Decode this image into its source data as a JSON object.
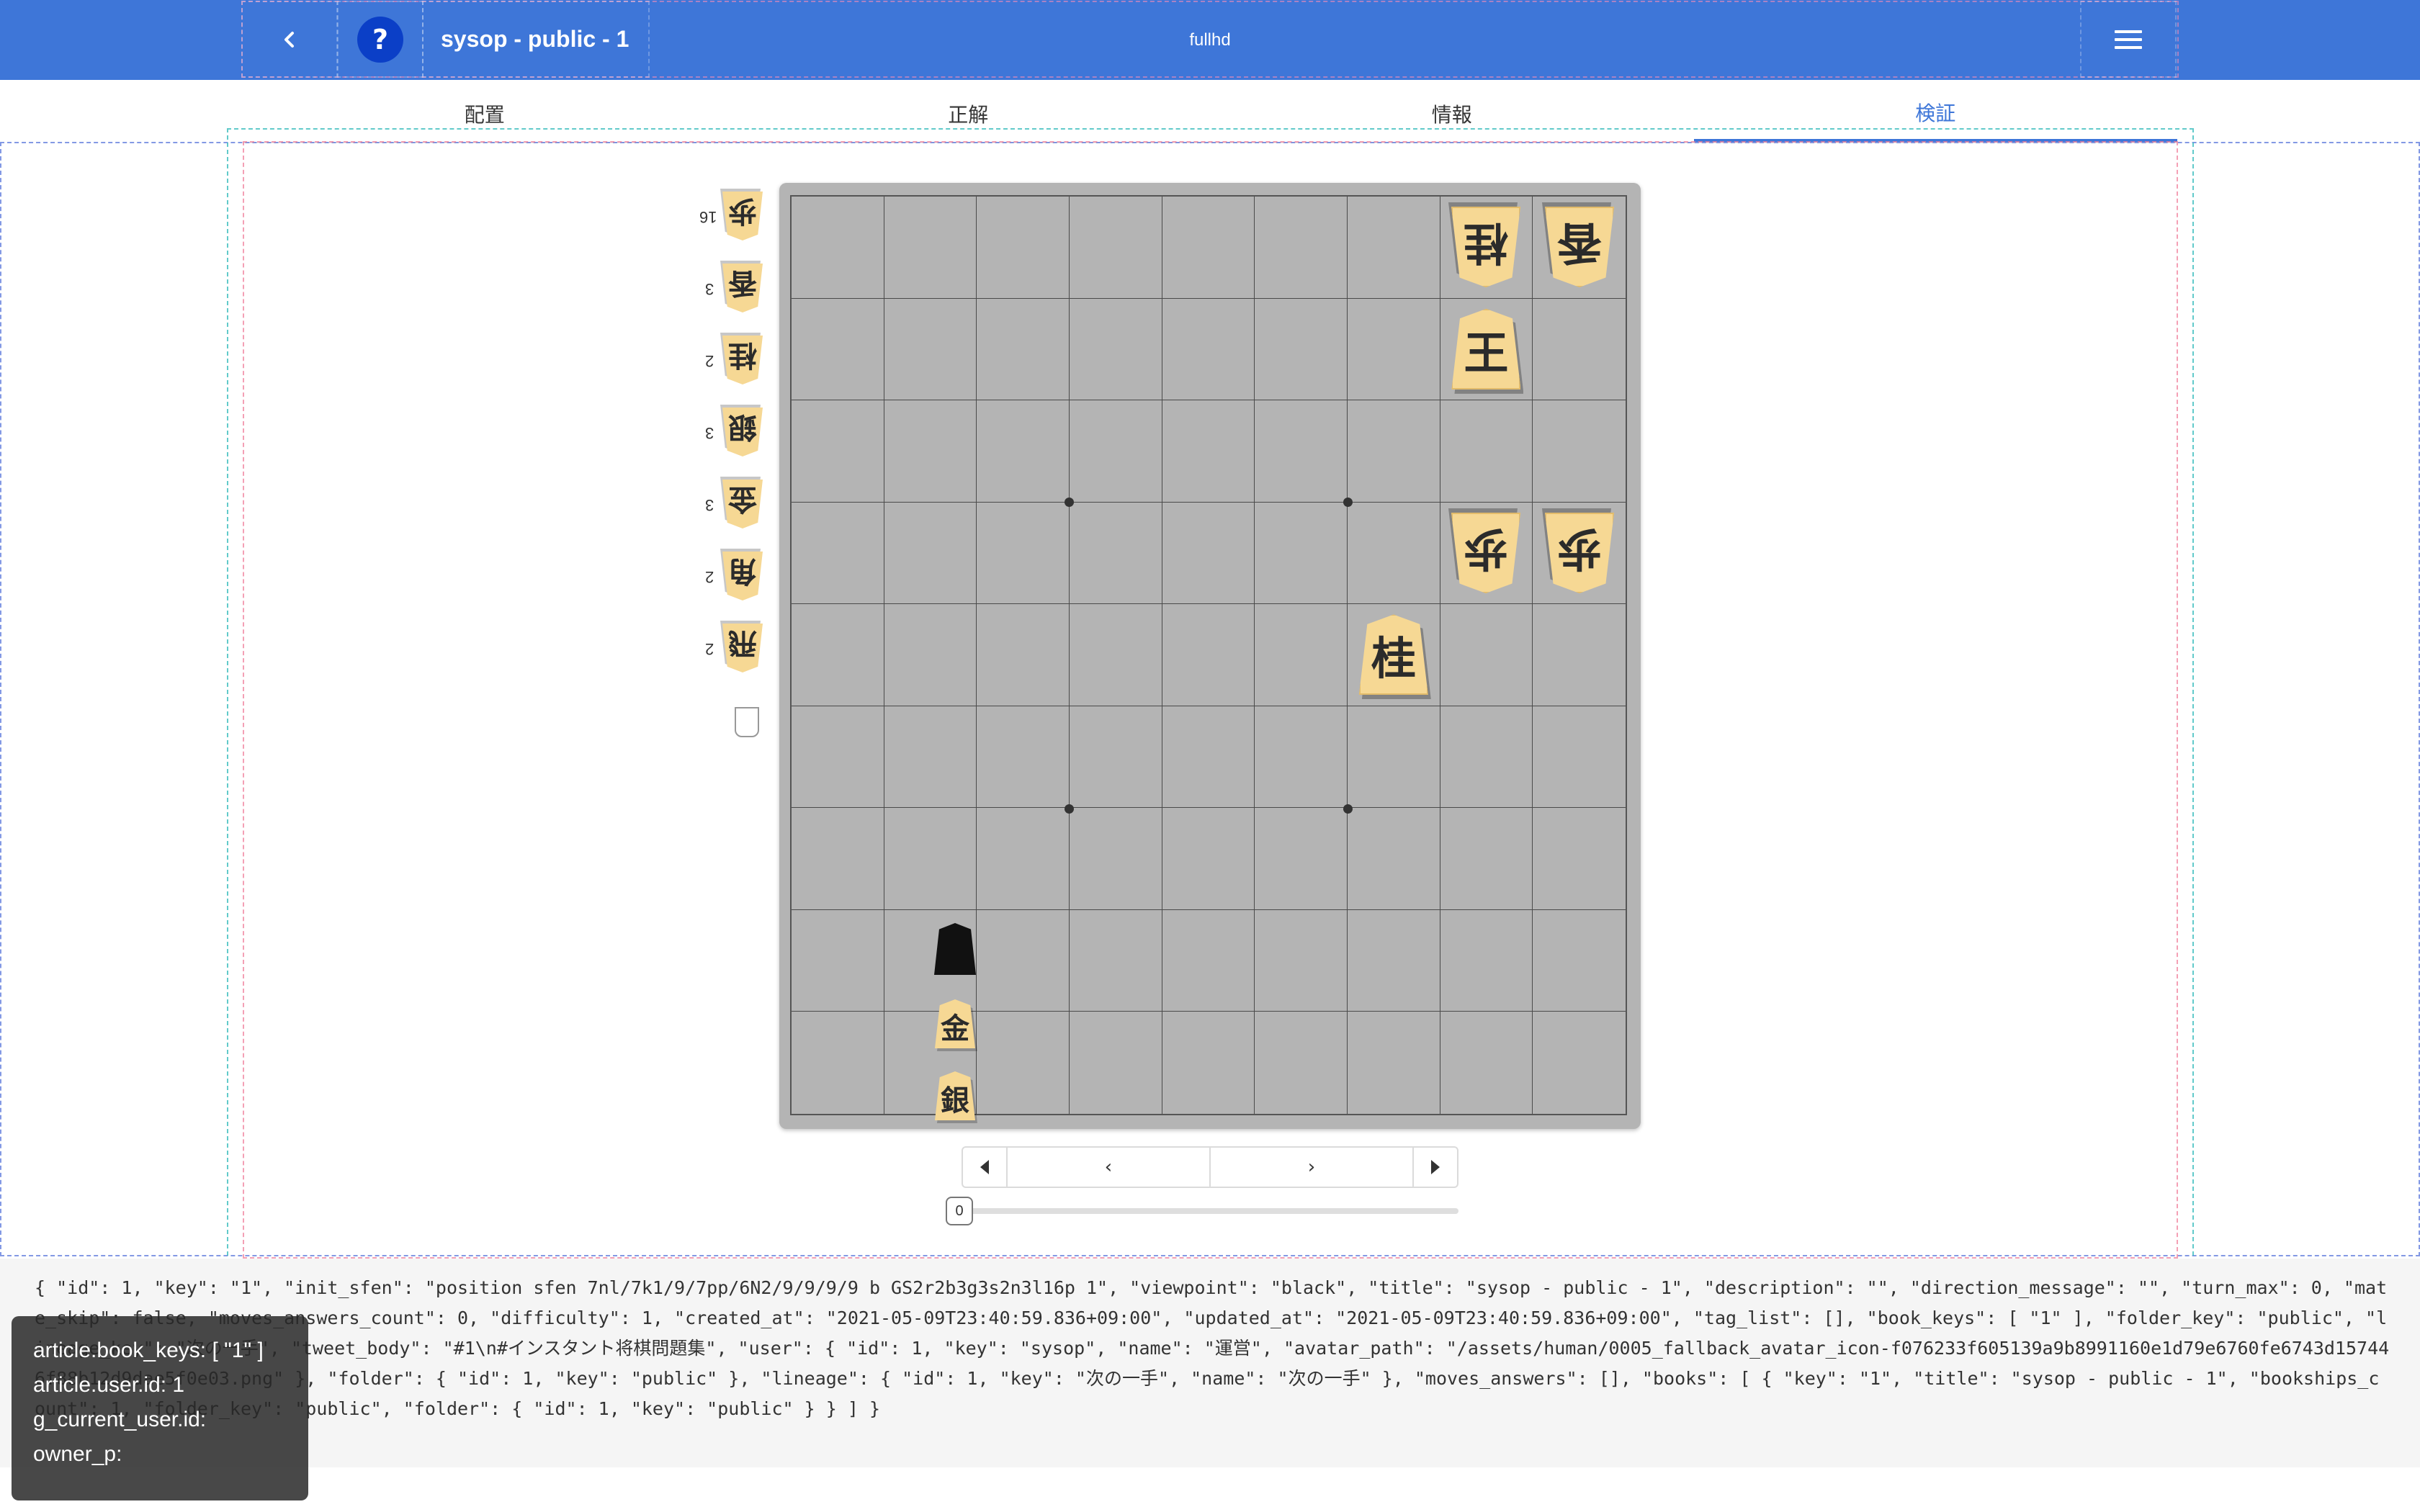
{
  "navbar": {
    "back_icon": "chevron-left-icon",
    "help_label": "?",
    "title": "sysop - public - 1",
    "center_label": "fullhd",
    "menu_icon": "hamburger-menu-icon",
    "bg_color": "#3e76d8"
  },
  "tabs": [
    {
      "label": "配置",
      "active": false
    },
    {
      "label": "正解",
      "active": false
    },
    {
      "label": "情報",
      "active": false
    },
    {
      "label": "検証",
      "active": true
    }
  ],
  "board": {
    "pieces": [
      {
        "rank": 1,
        "file": 2,
        "glyph": "桂",
        "side": "gote"
      },
      {
        "rank": 1,
        "file": 1,
        "glyph": "香",
        "side": "gote"
      },
      {
        "rank": 2,
        "file": 2,
        "glyph": "王",
        "side": "sente"
      },
      {
        "rank": 4,
        "file": 2,
        "glyph": "歩",
        "side": "gote"
      },
      {
        "rank": 4,
        "file": 1,
        "glyph": "歩",
        "side": "gote"
      },
      {
        "rank": 5,
        "file": 3,
        "glyph": "桂",
        "side": "sente"
      }
    ],
    "gote_hand": [
      {
        "glyph": "歩",
        "count": "16"
      },
      {
        "glyph": "香",
        "count": "3"
      },
      {
        "glyph": "桂",
        "count": "2"
      },
      {
        "glyph": "銀",
        "count": "3"
      },
      {
        "glyph": "金",
        "count": "3"
      },
      {
        "glyph": "角",
        "count": "2"
      },
      {
        "glyph": "飛",
        "count": "2"
      }
    ],
    "sente_hand": [
      {
        "glyph": "金"
      },
      {
        "glyph": "銀"
      }
    ]
  },
  "controls": {
    "first_icon": "caret-left-icon",
    "prev_label": "‹",
    "next_label": "›",
    "last_icon": "caret-right-icon",
    "slider_value": "0"
  },
  "dump_text": "{ \"id\": 1, \"key\": \"1\", \"init_sfen\": \"position sfen 7nl/7k1/9/7pp/6N2/9/9/9/9 b GS2r2b3g3s2n3l16p 1\", \"viewpoint\": \"black\", \"title\": \"sysop - public - 1\", \"description\": \"\", \"direction_message\": \"\", \"turn_max\": 0, \"mate_skip\": false, \"moves_answers_count\": 0, \"difficulty\": 1, \"created_at\": \"2021-05-09T23:40:59.836+09:00\", \"updated_at\": \"2021-05-09T23:40:59.836+09:00\", \"tag_list\": [], \"book_keys\": [ \"1\" ], \"folder_key\": \"public\", \"lineage_key\": \"次の一手\", \"tweet_body\": \"#1\\n#インスタント将棋問題集\", \"user\": { \"id\": 1, \"key\": \"sysop\", \"name\": \"運営\", \"avatar_path\": \"/assets/human/0005_fallback_avatar_icon-f076233f605139a9b8991160e1d79e6760fe6743d157446f88b12d9dae5f0e03.png\" }, \"folder\": { \"id\": 1, \"key\": \"public\" }, \"lineage\": { \"id\": 1, \"key\": \"次の一手\", \"name\": \"次の一手\" }, \"moves_answers\": [], \"books\": [ { \"key\": \"1\", \"title\": \"sysop - public - 1\", \"bookships_count\": 1, \"folder_key\": \"public\", \"folder\": { \"id\": 1, \"key\": \"public\" } } ] }",
  "debug": {
    "line1": "article.book_keys: [ \"1\" ]",
    "line2": "article.user.id: 1",
    "line3": "g_current_user.id:",
    "line4": "owner_p:"
  }
}
